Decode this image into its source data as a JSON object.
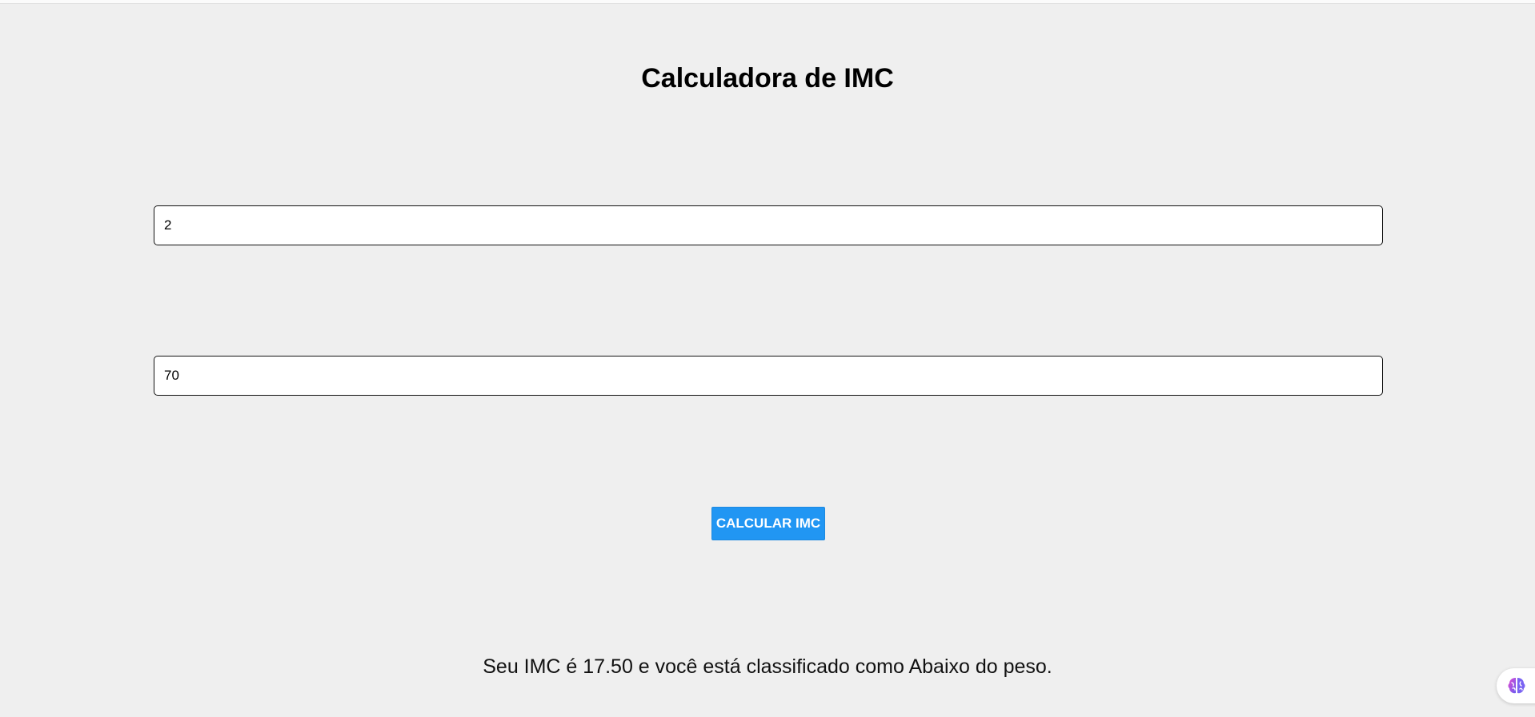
{
  "page": {
    "title": "Calculadora de IMC"
  },
  "form": {
    "height_value": "2",
    "weight_value": "70",
    "button_label": "CALCULAR IMC"
  },
  "result": {
    "text": "Seu IMC é 17.50 e você está classificado como Abaixo do peso."
  },
  "widgets": {
    "extension_icon": "brain-icon"
  },
  "colors": {
    "background": "#efefef",
    "button": "#2196f3",
    "button_text": "#ffffff"
  }
}
